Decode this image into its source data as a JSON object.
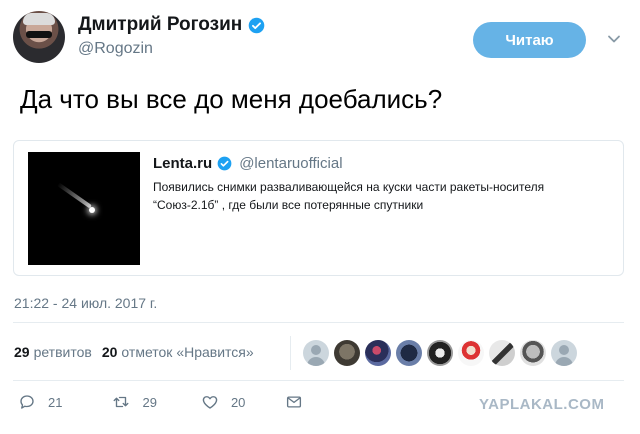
{
  "author": {
    "name": "Дмитрий Рогозин",
    "handle": "@Rogozin",
    "follow_label": "Читаю"
  },
  "tweet": {
    "text": "Да что вы все до меня доебались?",
    "timestamp": "21:22 - 24 июл. 2017 г."
  },
  "quote": {
    "name": "Lenta.ru",
    "handle": "@lentaruofficial",
    "text_line1": "Появились снимки разваливающейся на куски части ракеты-носителя",
    "text_line2": "“Союз-2.1б” , где были все потерянные спутники"
  },
  "stats": {
    "retweets_count": "29",
    "retweets_label": "ретвитов",
    "likes_count": "20",
    "likes_label": "отметок «Нравится»"
  },
  "actions": {
    "reply_count": "21",
    "retweet_count": "29",
    "like_count": "20"
  },
  "watermark": "YAPLAKAL.COM",
  "colors": {
    "follow_button": "#66b3e6",
    "verified": "#1da1f2",
    "secondary_text": "#657786"
  }
}
